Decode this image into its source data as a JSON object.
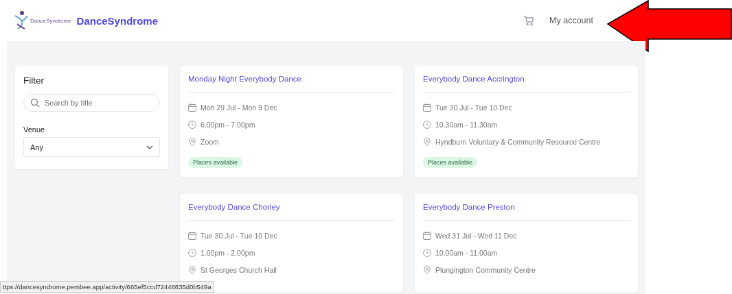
{
  "header": {
    "logo_text": "DanceSyndrome",
    "brand": "DanceSyndrome",
    "account_link": "My account"
  },
  "filter": {
    "title": "Filter",
    "search": {
      "placeholder": "Search by title"
    },
    "venue_label": "Venue",
    "venue_value": "Any"
  },
  "activities": [
    {
      "title": "Monday Night Everybody Dance",
      "dates": "Mon 29 Jul - Mon 9 Dec",
      "time": "6.00pm - 7.00pm",
      "venue": "Zoom",
      "badge": "Places available"
    },
    {
      "title": "Everybody Dance Accrington",
      "dates": "Tue 30 Jul - Tue 10 Dec",
      "time": "10.30am - 11.30am",
      "venue": "Hyndburn Voluntary & Community Resource Centre",
      "badge": "Places available"
    },
    {
      "title": "Everybody Dance Chorley",
      "dates": "Tue 30 Jul - Tue 10 Dec",
      "time": "1.00pm - 2.00pm",
      "venue": "St Georges Church Hall"
    },
    {
      "title": "Everybody Dance Preston",
      "dates": "Wed 31 Jul - Wed 11 Dec",
      "time": "10.00am - 11.00am",
      "venue": "Plungington Community Centre"
    }
  ],
  "status_bar": {
    "url": "ttps://dancesyndrome.pembee.app/activity/665ef5ccd72448835d0b549a"
  }
}
